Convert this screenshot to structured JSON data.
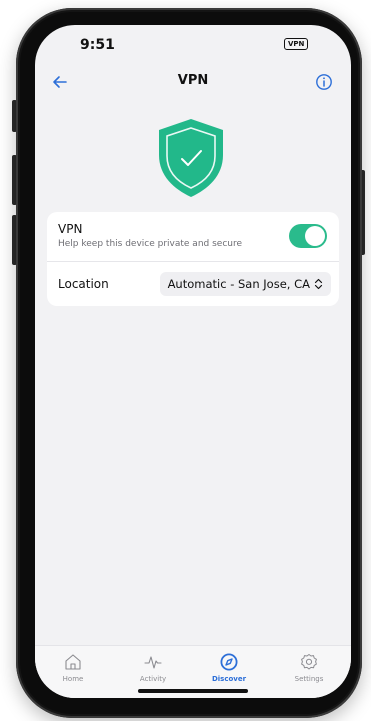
{
  "status_bar": {
    "time": "9:51",
    "vpn_badge": "VPN"
  },
  "nav": {
    "title": "VPN"
  },
  "vpn_row": {
    "title": "VPN",
    "subtitle": "Help keep this device private and secure",
    "enabled": true
  },
  "location_row": {
    "label": "Location",
    "value": "Automatic - San Jose, CA"
  },
  "tabs": [
    {
      "label": "Home",
      "icon": "home-icon",
      "active": false
    },
    {
      "label": "Activity",
      "icon": "activity-icon",
      "active": false
    },
    {
      "label": "Discover",
      "icon": "compass-icon",
      "active": true
    },
    {
      "label": "Settings",
      "icon": "gear-icon",
      "active": false
    }
  ],
  "colors": {
    "accent_blue": "#2d6fd8",
    "toggle_green": "#2abb8c",
    "shield_green": "#22b88a",
    "background": "#f2f2f4"
  }
}
